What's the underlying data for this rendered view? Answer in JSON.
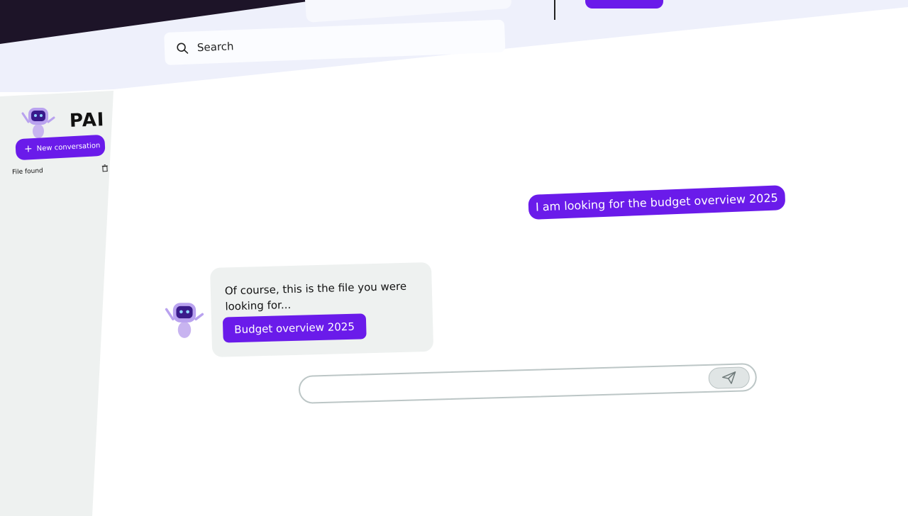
{
  "header": {
    "search_placeholder": "Search"
  },
  "sidebar": {
    "brand": "PAI",
    "new_conversation_label": "New conversation",
    "items": [
      {
        "label": "File found"
      }
    ]
  },
  "chat": {
    "messages": [
      {
        "role": "user",
        "text": "I am looking for the budget overview 2025"
      },
      {
        "role": "assistant",
        "text": "Of course, this is the file you were looking for...",
        "attachment_label": "Budget overview 2025"
      }
    ],
    "composer_value": ""
  },
  "colors": {
    "accent": "#6a1bea",
    "sidebar_bg": "#eef1f0",
    "header_bg": "#eef0fb"
  },
  "icons": {
    "search": "search-icon",
    "plus": "plus-icon",
    "trash": "trash-icon",
    "send": "send-icon",
    "avatar": "robot-avatar-icon"
  }
}
